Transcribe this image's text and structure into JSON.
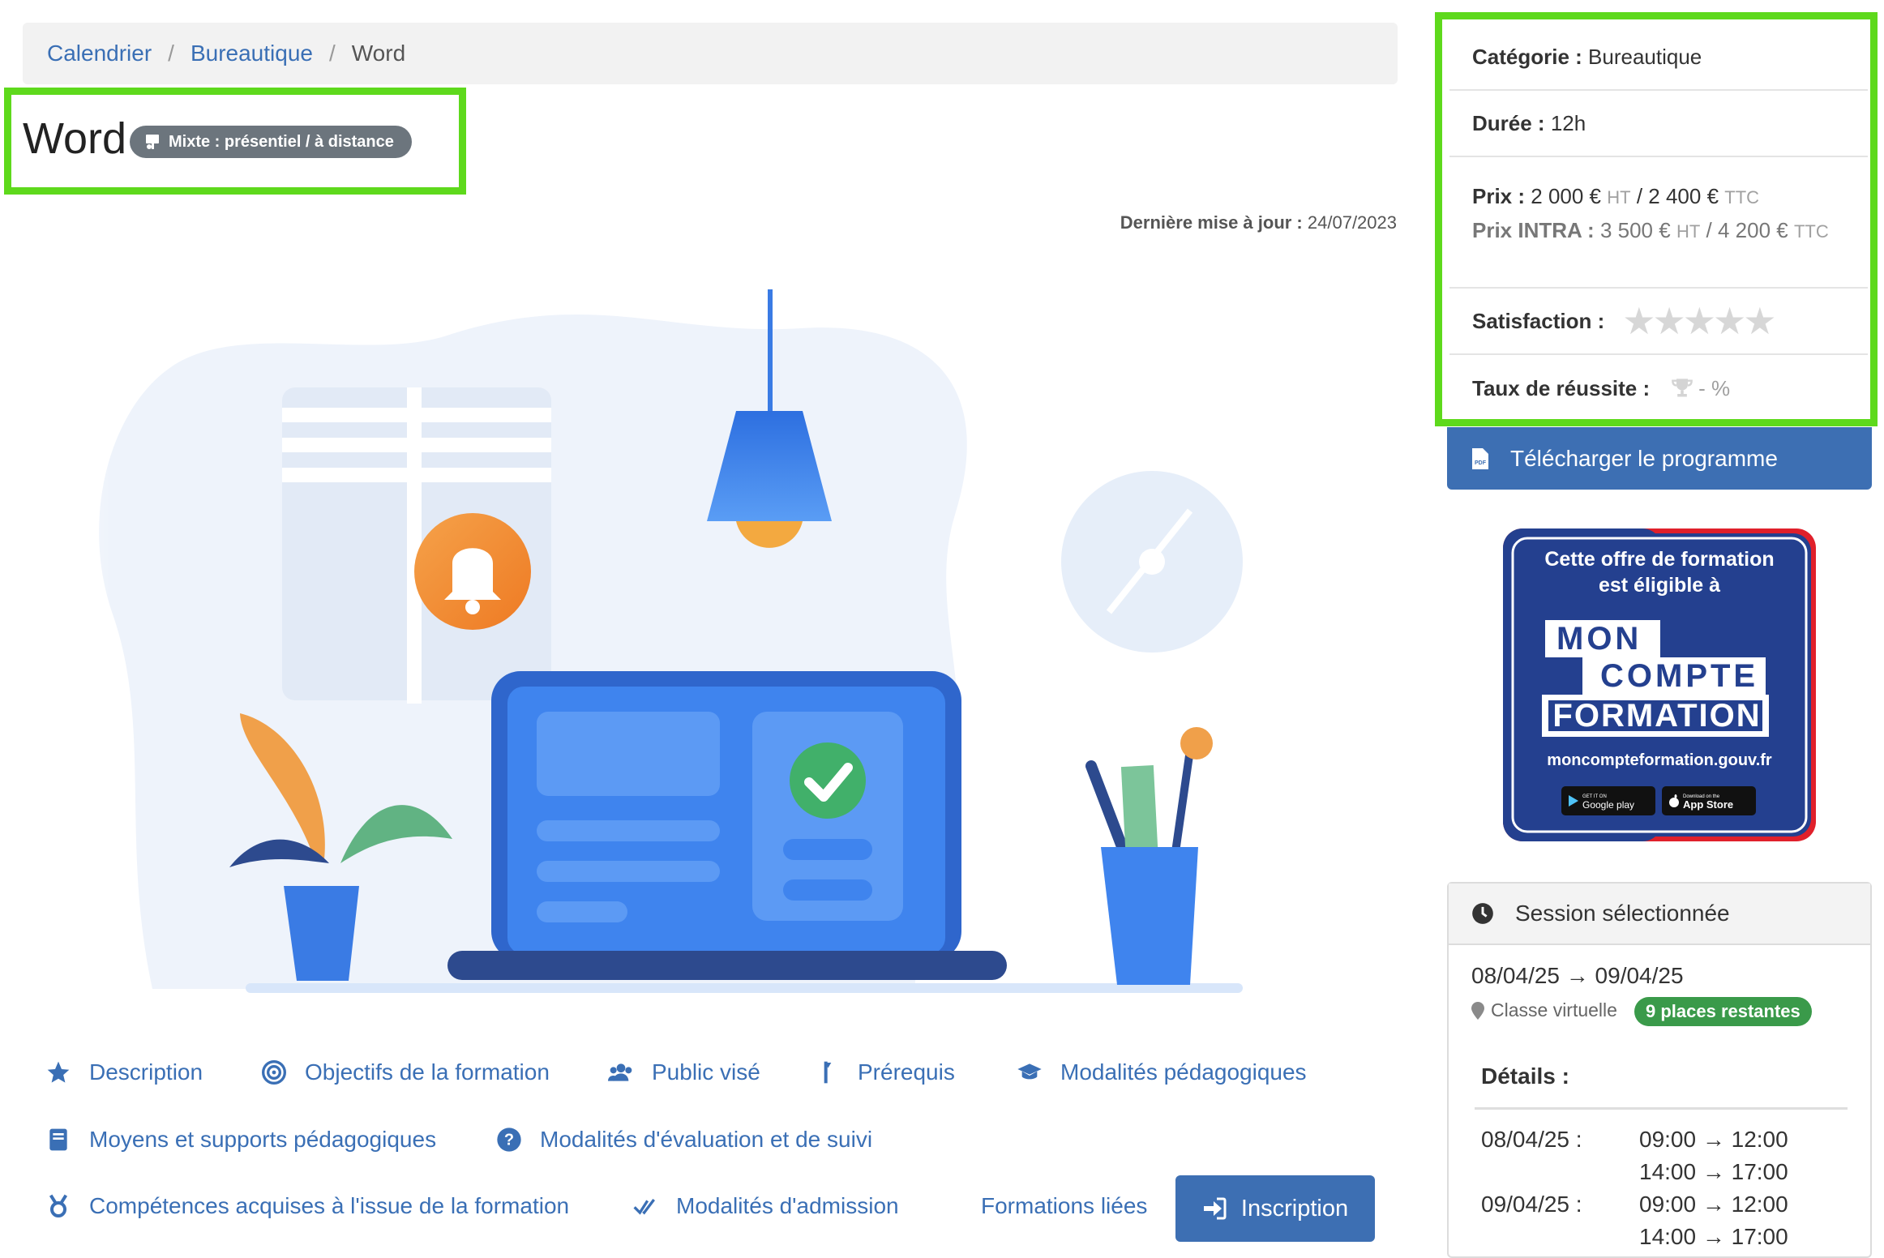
{
  "breadcrumb": [
    {
      "label": "Calendrier",
      "link": true
    },
    {
      "label": "Bureautique",
      "link": true
    },
    {
      "label": "Word",
      "link": false
    }
  ],
  "title": "Word",
  "mode_badge": {
    "label": "Mixte : présentiel / à distance",
    "icon": "chalkboard-icon"
  },
  "last_update": {
    "label": "Dernière mise à jour :",
    "value": "24/07/2023"
  },
  "info": {
    "category_label": "Catégorie :",
    "category": "Bureautique",
    "duration_label": "Durée :",
    "duration": "12h",
    "price_label": "Prix :",
    "price_ht": "2 000 €",
    "ht": "HT",
    "price_sep": "/",
    "price_ttc": "2 400 €",
    "ttc": "TTC",
    "intra_label": "Prix INTRA :",
    "intra_ht": "3 500 €",
    "intra_ttc": "4 200 €",
    "satisfaction_label": "Satisfaction :",
    "satisfaction_stars": "★★★★★",
    "satisfaction_rating": 0,
    "success_label": "Taux de réussite :",
    "success_value": "- %"
  },
  "download_label": "Télécharger le programme",
  "cpf": {
    "line1": "Cette offre de formation",
    "line2": "est éligible à",
    "mon": "MON",
    "compte": "COMPTE",
    "formation": "FORMATION",
    "url": "moncompteformation.gouv.fr",
    "google_small": "GET IT ON",
    "google": "Google play",
    "apple_small": "Download on the",
    "apple": "App Store"
  },
  "nav_links": [
    {
      "label": "Description",
      "icon": "star-icon"
    },
    {
      "label": "Objectifs de la formation",
      "icon": "target-icon"
    },
    {
      "label": "Public visé",
      "icon": "users-icon"
    },
    {
      "label": "Prérequis",
      "icon": "flag-icon"
    },
    {
      "label": "Modalités pédagogiques",
      "icon": "graduation-cap-icon"
    },
    {
      "label": "Moyens et supports pédagogiques",
      "icon": "book-icon"
    },
    {
      "label": "Modalités d'évaluation et de suivi",
      "icon": "question-circle-icon"
    },
    {
      "label": "Compétences acquises à l'issue de la formation",
      "icon": "medal-icon"
    },
    {
      "label": "Modalités d'admission",
      "icon": "double-check-icon"
    },
    {
      "label": "Formations liées",
      "icon": ""
    }
  ],
  "inscription_label": "Inscription",
  "session": {
    "title": "Session sélectionnée",
    "dates": "08/04/25 → 09/04/25",
    "location": "Classe virtuelle",
    "places": "9 places restantes",
    "details_title": "Détails :",
    "schedule": [
      {
        "date": "08/04/25 :",
        "slots": [
          "09:00 → 12:00",
          "14:00 → 17:00"
        ]
      },
      {
        "date": "09/04/25 :",
        "slots": [
          "09:00 → 12:00",
          "14:00 → 17:00"
        ]
      }
    ]
  },
  "colors": {
    "primary": "#3d6fb3",
    "link": "#3a6fb5",
    "highlight": "#5ed91c",
    "success": "#3a9a4a",
    "badge": "#6c757d"
  }
}
